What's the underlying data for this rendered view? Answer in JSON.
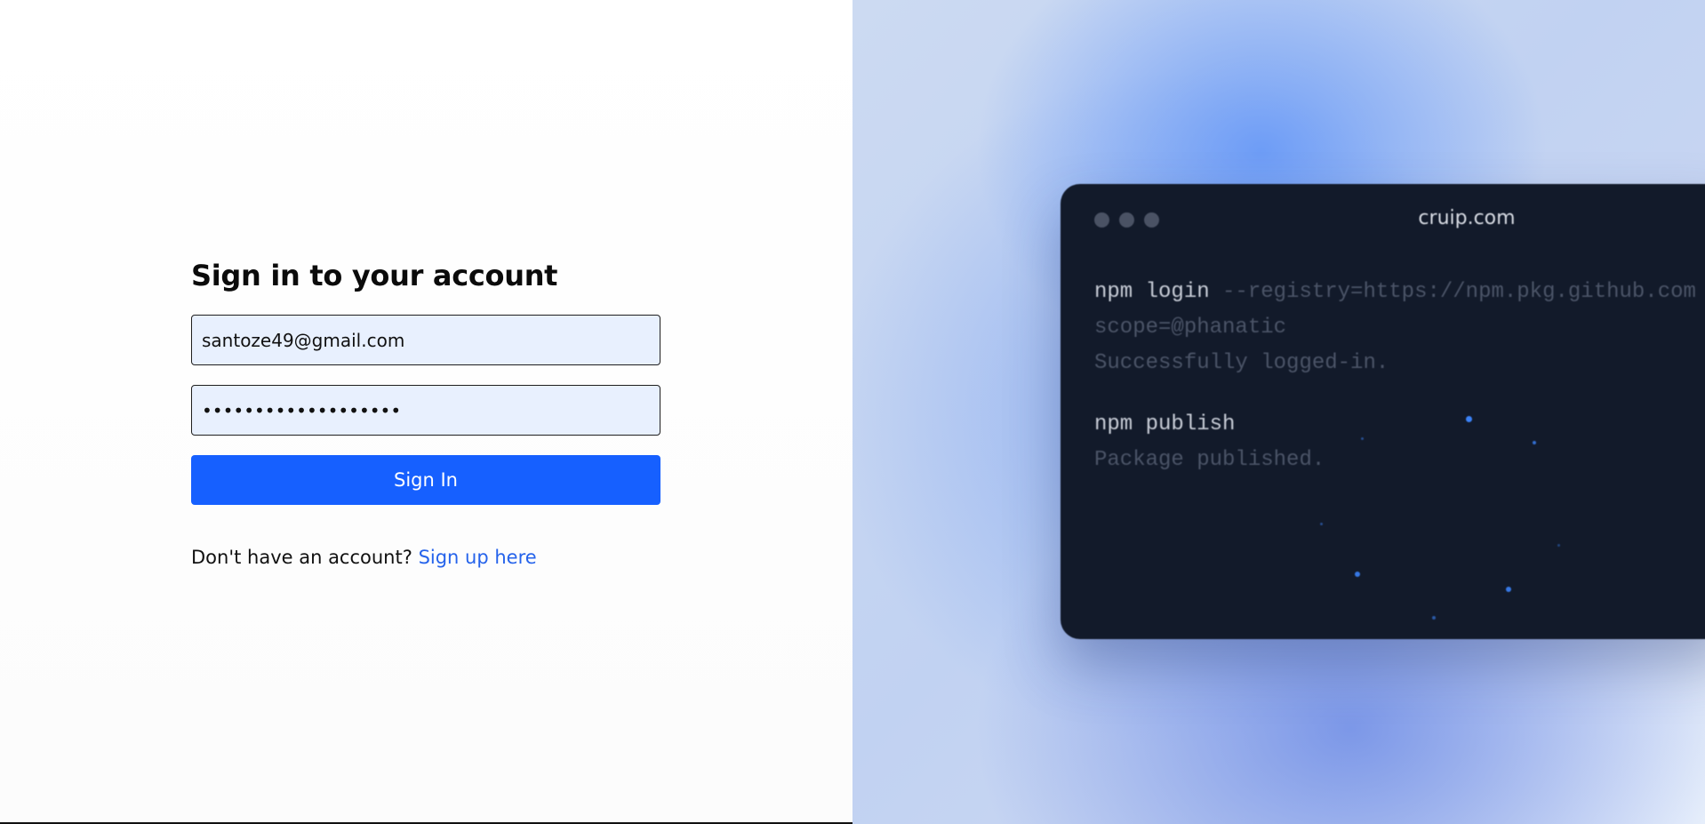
{
  "form": {
    "title": "Sign in to your account",
    "email_value": "santoze49@gmail.com",
    "password_masked": "•••••••••••••••••••",
    "signin_label": "Sign In",
    "signup_prompt": "Don't have an account?",
    "signup_link": "Sign up here"
  },
  "terminal": {
    "title": "cruip.com",
    "lines": {
      "l1_cmd": "npm login",
      "l1_arg": " --registry=https://npm.pkg.github.com",
      "l2": "scope=@phanatic",
      "l3": "Successfully logged-in.",
      "l4_cmd": "npm publish",
      "l5": "Package published."
    }
  },
  "colors": {
    "accent": "#1660ff",
    "link": "#2563eb",
    "input_bg": "#e8f0fe",
    "terminal_bg": "#121a2a"
  }
}
